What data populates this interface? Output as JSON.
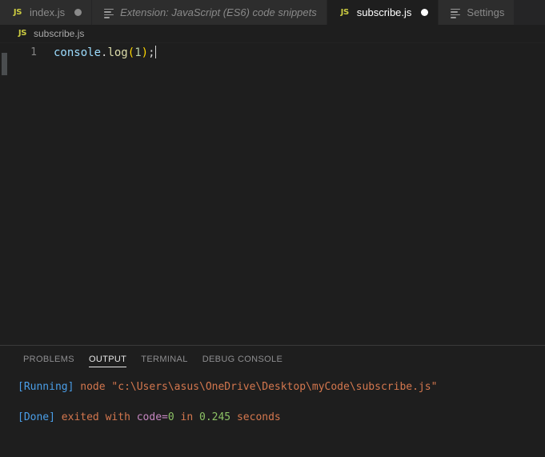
{
  "window": {
    "background": "#1e1e1e"
  },
  "tabbar": {
    "tabs": [
      {
        "label": "index.js",
        "icon": "js-file-icon",
        "icon_text": "JS",
        "active": false,
        "preview": false,
        "dirty": true
      },
      {
        "label": "Extension: JavaScript (ES6) code snippets",
        "icon": "extension-lines-icon",
        "icon_text": "",
        "active": false,
        "preview": true,
        "dirty": false
      },
      {
        "label": "subscribe.js",
        "icon": "js-file-icon",
        "icon_text": "JS",
        "active": true,
        "preview": false,
        "dirty": true
      },
      {
        "label": "Settings",
        "icon": "settings-lines-icon",
        "icon_text": "",
        "active": false,
        "preview": false,
        "dirty": false
      }
    ]
  },
  "breadcrumb": {
    "icon_text": "JS",
    "label": "subscribe.js"
  },
  "editor": {
    "line_number": "1",
    "code": {
      "object": "console",
      "dot": ".",
      "method": "log",
      "paren_open": "(",
      "argument": "1",
      "paren_close": ")",
      "semicolon": ";"
    }
  },
  "panel": {
    "tabs": [
      {
        "label": "PROBLEMS",
        "active": false
      },
      {
        "label": "OUTPUT",
        "active": true
      },
      {
        "label": "TERMINAL",
        "active": false
      },
      {
        "label": "DEBUG CONSOLE",
        "active": false
      }
    ],
    "output": {
      "running_tag": "[Running]",
      "running_command": "node \"c:\\Users\\asus\\OneDrive\\Desktop\\myCode\\subscribe.js\"",
      "done_tag": "[Done]",
      "done_text_1": "exited with ",
      "done_code_key": "code=",
      "done_code_value": "0",
      "done_text_2": " in ",
      "done_duration": "0.245",
      "done_text_3": " seconds"
    }
  },
  "colors": {
    "editor_bg": "#1e1e1e",
    "tab_inactive_bg": "#2d2d2d",
    "tabbar_bg": "#252526",
    "js_icon": "#cbcb41",
    "accent_blue": "#4a9ee8",
    "accent_orange": "#d4774e",
    "accent_green": "#8cc265",
    "accent_magenta": "#c586c0"
  }
}
